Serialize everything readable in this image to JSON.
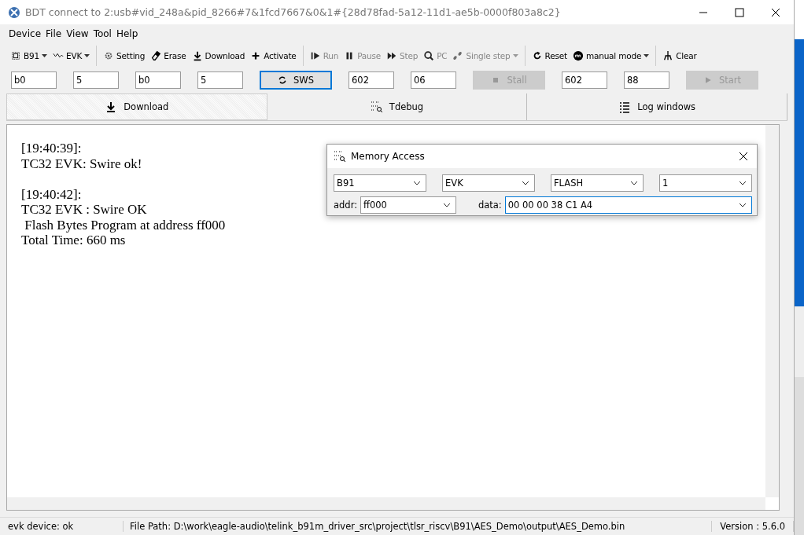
{
  "window": {
    "title": "BDT connect to 2:usb#vid_248a&pid_8266#7&1fcd7667&0&1#{28d78fad-5a12-11d1-ae5b-0000f803a8c2}"
  },
  "menu": [
    "Device",
    "File",
    "View",
    "Tool",
    "Help"
  ],
  "toolbar": [
    {
      "kind": "dropdown",
      "label": "B91",
      "disabled": false
    },
    {
      "kind": "dropdown",
      "label": "EVK",
      "disabled": false
    },
    {
      "kind": "separator"
    },
    {
      "kind": "button",
      "label": "Setting",
      "disabled": false
    },
    {
      "kind": "button",
      "label": "Erase",
      "disabled": false
    },
    {
      "kind": "button",
      "label": "Download",
      "disabled": false
    },
    {
      "kind": "button",
      "label": "Activate",
      "disabled": false
    },
    {
      "kind": "separator"
    },
    {
      "kind": "button",
      "label": "Run",
      "disabled": true
    },
    {
      "kind": "button",
      "label": "Pause",
      "disabled": true
    },
    {
      "kind": "button",
      "label": "Step",
      "disabled": true
    },
    {
      "kind": "button",
      "label": "PC",
      "disabled": true
    },
    {
      "kind": "dropdown",
      "label": "Single step",
      "disabled": true
    },
    {
      "kind": "separator"
    },
    {
      "kind": "button",
      "label": "Reset",
      "disabled": false
    },
    {
      "kind": "dropdown",
      "label": "manual mode",
      "disabled": false
    },
    {
      "kind": "separator"
    },
    {
      "kind": "button",
      "label": "Clear",
      "disabled": false
    }
  ],
  "fieldbar": [
    {
      "kind": "field",
      "value": "b0"
    },
    {
      "kind": "field",
      "value": "5"
    },
    {
      "kind": "field",
      "value": "b0"
    },
    {
      "kind": "field",
      "value": "5"
    },
    {
      "kind": "button",
      "label": "SWS",
      "disabled": false,
      "focused": true
    },
    {
      "kind": "field",
      "value": "602"
    },
    {
      "kind": "field",
      "value": "06"
    },
    {
      "kind": "button",
      "label": "Stall",
      "disabled": true,
      "focused": false
    },
    {
      "kind": "field",
      "value": "602"
    },
    {
      "kind": "field",
      "value": "88"
    },
    {
      "kind": "button",
      "label": "Start",
      "disabled": true,
      "focused": false
    }
  ],
  "tabs": [
    {
      "label": "Download",
      "selected": true
    },
    {
      "label": "Tdebug",
      "selected": false
    },
    {
      "label": "Log windows",
      "selected": false
    }
  ],
  "log": [
    {
      "lines": [
        "[19:40:39]:",
        "TC32 EVK: Swire ok!"
      ]
    },
    {
      "lines": [
        "[19:40:42]:",
        "TC32 EVK : Swire OK",
        " Flash Bytes Program at address ff000",
        "Total Time: 660 ms"
      ]
    }
  ],
  "dialog": {
    "title": "Memory Access",
    "selects": [
      "B91",
      "EVK",
      "FLASH",
      "1"
    ],
    "addr_label": "addr:",
    "addr": "ff000",
    "data_label": "data:",
    "data": "00 00 00 38 C1 A4"
  },
  "status_bar": [
    "evk device: ok",
    "File Path:  D:\\work\\eagle-audio\\telink_b91m_driver_src\\project\\tlsr_riscv\\B91\\AES_Demo\\output\\AES_Demo.bin",
    "Version : 5.6.0"
  ]
}
